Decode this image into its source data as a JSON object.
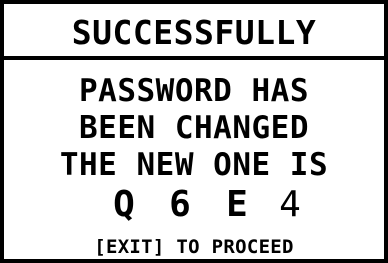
{
  "dialog": {
    "title": "SUCCESSFULLY",
    "message_lines": [
      "PASSWORD HAS",
      "BEEN CHANGED",
      "THE NEW ONE IS"
    ],
    "code": [
      "Q",
      "6",
      "E",
      "4"
    ],
    "hint": "[EXIT] TO PROCEED"
  },
  "colors": {
    "background": "#ffffff",
    "foreground": "#000000"
  }
}
